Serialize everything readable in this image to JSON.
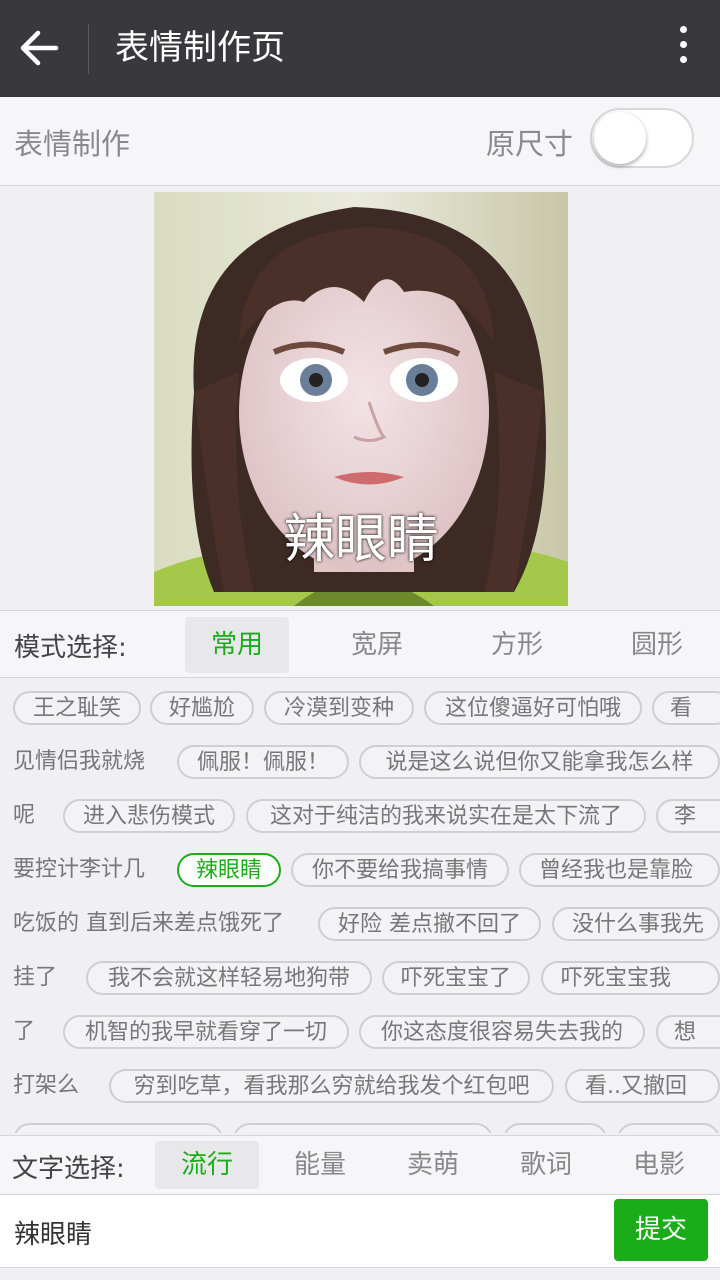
{
  "header": {
    "title": "表情制作页",
    "back_icon": "back-arrow-icon",
    "more_icon": "more-vertical-icon"
  },
  "make_bar": {
    "label": "表情制作",
    "original_size_label": "原尺寸",
    "original_size_on": false
  },
  "preview": {
    "caption": "辣眼睛"
  },
  "mode": {
    "label": "模式选择:",
    "tabs": [
      "常用",
      "宽屏",
      "方形",
      "圆形"
    ],
    "active": "常用"
  },
  "tags": {
    "t1": "王之耻笑",
    "t2": "好尴尬",
    "t3": "冷漠到变种",
    "t4": "这位傻逼好可怕哦",
    "t5a": "看",
    "t5b": "见情侣我就烧",
    "t6": "佩服！佩服！",
    "t7a": "说是这么说但你又能拿我怎么样",
    "t7b": "呢",
    "t8": "进入悲伤模式",
    "t9": "这对于纯洁的我来说实在是太下流了",
    "t10a": "李",
    "t10b": "要控计李计几",
    "t11": "辣眼睛",
    "t12": "你不要给我搞事情",
    "t13a": "曾经我也是靠脸",
    "t13b": "吃饭的 直到后来差点饿死了",
    "t14": "好险 差点撤不回了",
    "t15a": "没什么事我先",
    "t15b": "挂了",
    "t16": "我不会就这样轻易地狗带",
    "t17": "吓死宝宝了",
    "t18a": "吓死宝宝我",
    "t18b": "了",
    "t19": "机智的我早就看穿了一切",
    "t20": "你这态度很容易失去我的",
    "t21a": "想",
    "t21b": "打架么",
    "t22": "穷到吃草，看我那么穷就给我发个红包吧",
    "t23": "看..又撤回"
  },
  "text_select": {
    "label": "文字选择:",
    "tabs": [
      "流行",
      "能量",
      "卖萌",
      "歌词",
      "电影"
    ],
    "active": "流行"
  },
  "input": {
    "value": "辣眼睛",
    "submit_label": "提交"
  },
  "colors": {
    "accent": "#1aad19",
    "header_bg": "#38383d"
  }
}
